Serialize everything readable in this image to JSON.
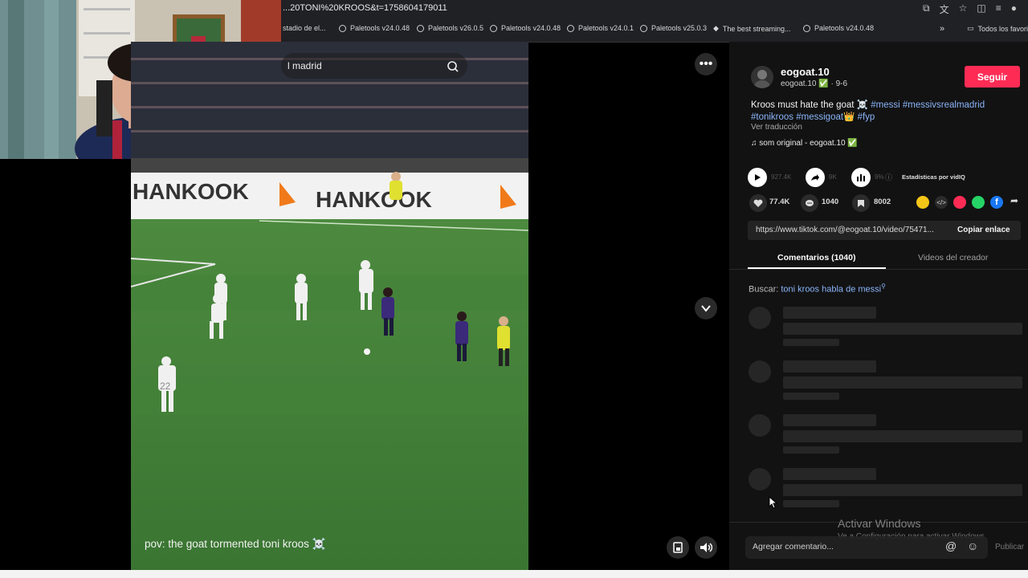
{
  "browser": {
    "url": "...20TONI%20KROOS&t=1758604179011",
    "bookmarks": [
      "stadio de el...",
      "Paletools v24.0.48",
      "Paletools v26.0.5",
      "Paletools v24.0.48",
      "Paletools v24.0.1",
      "Paletools v25.0.3",
      "The best streaming...",
      "Paletools v24.0.48"
    ],
    "more": "»",
    "all_favorites": "Todos los favori"
  },
  "video": {
    "search_text": "l madrid",
    "caption": "pov: the goat tormented toni kroos ☠️",
    "board_text": "HANKOOK",
    "player_number": "22"
  },
  "creator": {
    "name": "eogoat.10",
    "handle": "eogoat.10 ✅ · 9-6",
    "follow_label": "Seguir",
    "description": "Kroos must hate the goat ☠️",
    "hashtags_line1": "#messi #messivsrealmadrid",
    "hashtags_line2": "#tonikroos #messigoat👑 #fyp ",
    "translate": "Ver traducción",
    "music": "som original - eogoat.10 ✅"
  },
  "vidiq": {
    "plays": "927.4K",
    "shares": "9K",
    "percent": "9%",
    "label": "Estadísticas por vidIQ"
  },
  "stats": {
    "likes": "77.4K",
    "comments": "1040",
    "saves": "8002"
  },
  "link": {
    "url": "https://www.tiktok.com/@eogoat.10/video/75471...",
    "copy_label": "Copiar enlace"
  },
  "tabs": {
    "comments": "Comentarios (1040)",
    "creator_videos": "Videos del creador"
  },
  "related_search": {
    "prefix": "Buscar:",
    "query": "toni kroos habla de messi"
  },
  "comment_box": {
    "placeholder": "Agregar comentario...",
    "publish": "Publicar"
  },
  "windows": {
    "activate_title": "Activar Windows",
    "activate_sub": "Ve a Configuración para activar Windows."
  },
  "colors": {
    "follow": "#fe2c55",
    "link_blue": "#8ab4f8",
    "panel_bg": "#121212"
  }
}
